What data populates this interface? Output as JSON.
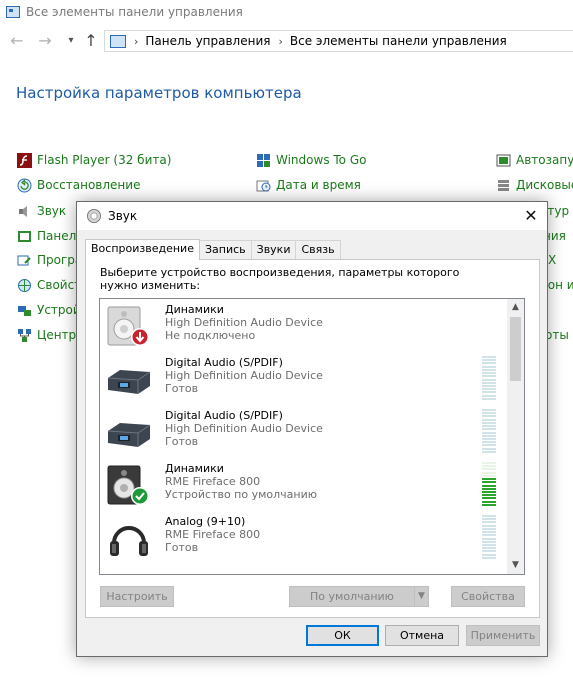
{
  "window": {
    "title": "Все элементы панели управления"
  },
  "address": {
    "crumbs": [
      "Панель управления",
      "Все элементы панели управления"
    ]
  },
  "page_heading": "Настройка параметров компьютера",
  "cp_items": {
    "col1": [
      "Flash Player (32 бита)",
      "Восстановление",
      "Звук",
      "Панель",
      "Програ",
      "Свойст",
      "Устрой",
      "Центр у"
    ],
    "col2": [
      "Windows To Go",
      "Дата и время"
    ],
    "col3": [
      "Автозапус",
      "Дисковые",
      "атур",
      "ния",
      "Х",
      "ион и",
      "оты"
    ]
  },
  "dialog": {
    "title": "Звук",
    "close": "✕",
    "tabs": [
      "Воспроизведение",
      "Запись",
      "Звуки",
      "Связь"
    ],
    "instruction": "Выберите устройство воспроизведения, параметры которого нужно изменить:",
    "devices": [
      {
        "name": "Динамики",
        "desc": "High Definition Audio Device",
        "status": "Не подключено",
        "icon": "speaker-disconnected-icon",
        "meter_level": 0
      },
      {
        "name": "Digital Audio (S/PDIF)",
        "desc": "High Definition Audio Device",
        "status": "Готов",
        "icon": "spdif-device-icon",
        "meter_level": 0
      },
      {
        "name": "Digital Audio (S/PDIF)",
        "desc": "High Definition Audio Device",
        "status": "Готов",
        "icon": "spdif-device-icon",
        "meter_level": 0
      },
      {
        "name": "Динамики",
        "desc": "RME Fireface 800",
        "status": "Устройство по умолчанию",
        "icon": "speaker-default-icon",
        "meter_level": 0.62
      },
      {
        "name": "Analog (9+10)",
        "desc": "RME Fireface 800",
        "status": "Готов",
        "icon": "headphones-icon",
        "meter_level": 0
      }
    ],
    "buttons": {
      "configure": "Настроить",
      "set_default": "По умолчанию",
      "properties": "Свойства",
      "ok": "ОК",
      "cancel": "Отмена",
      "apply": "Применить"
    }
  },
  "colors": {
    "heading": "#1e5aa8",
    "link_green": "#1a7a1a",
    "focus_blue": "#0078d7",
    "meter_green": "#2ca52c",
    "meter_idle": "#cfe3e8"
  }
}
